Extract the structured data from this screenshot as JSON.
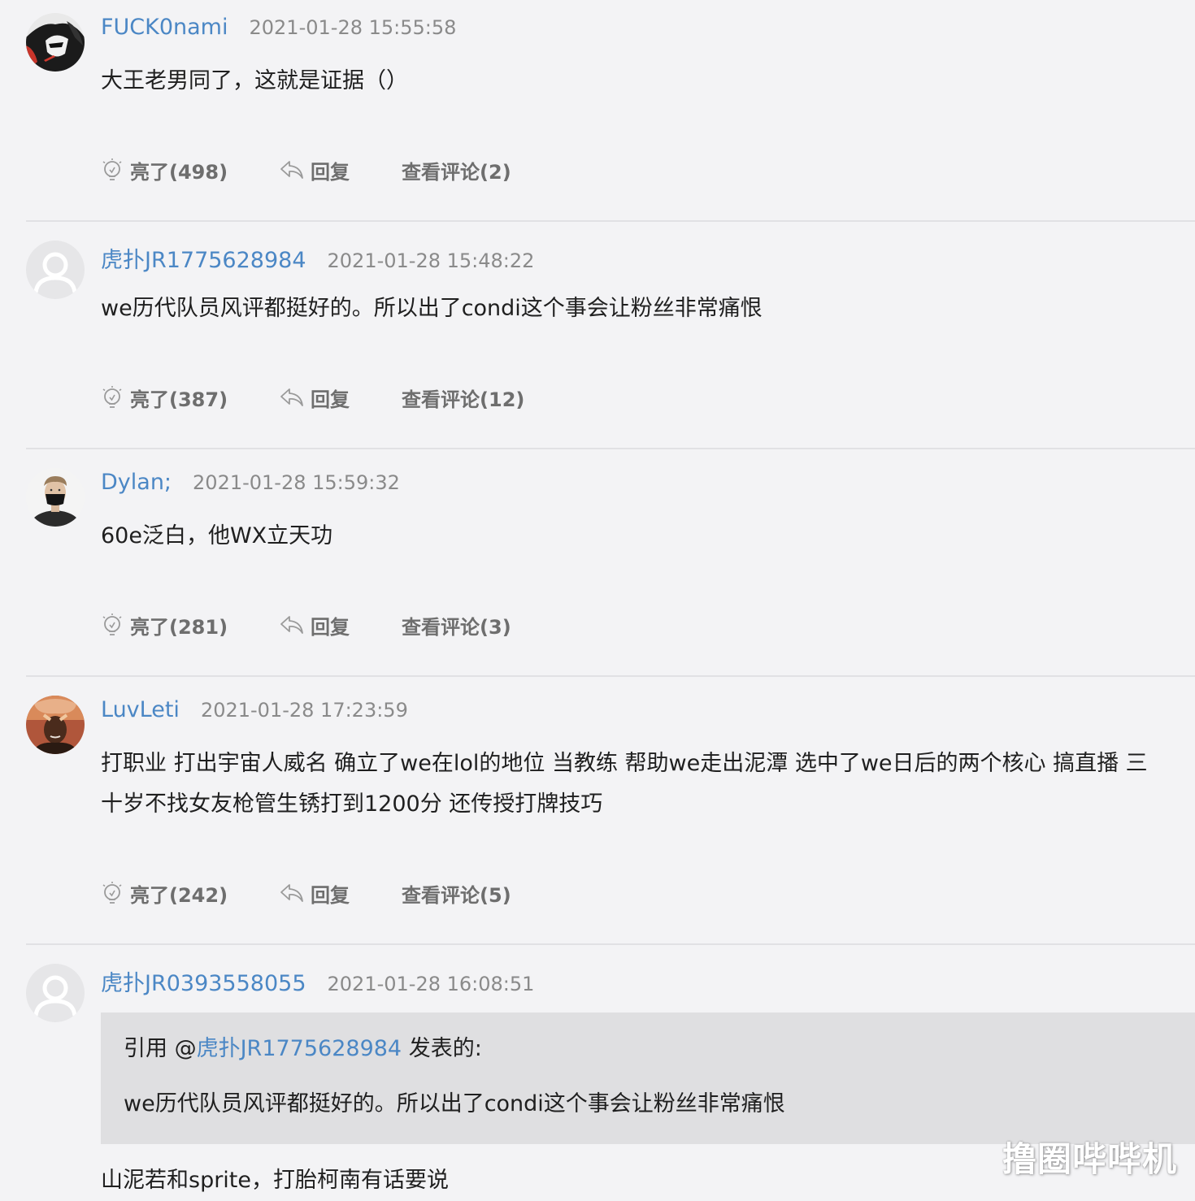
{
  "comments": [
    {
      "username": "FUCK0nami",
      "time": "2021-01-28 15:55:58",
      "text": "大王老男同了，这就是证据（）",
      "likes": "亮了(498)",
      "reply": "回复",
      "view": "查看评论(2)",
      "avatar": "dark-illustration-avatar"
    },
    {
      "username": "虎扑JR1775628984",
      "time": "2021-01-28 15:48:22",
      "text": "we历代队员风评都挺好的。所以出了condi这个事会让粉丝非常痛恨",
      "likes": "亮了(387)",
      "reply": "回复",
      "view": "查看评论(12)",
      "avatar": "default-user-avatar"
    },
    {
      "username": "Dylan;",
      "time": "2021-01-28 15:59:32",
      "text": "60e泛白，他WX立天功",
      "likes": "亮了(281)",
      "reply": "回复",
      "view": "查看评论(3)",
      "avatar": "masked-man-avatar"
    },
    {
      "username": "LuvLeti",
      "time": "2021-01-28 17:23:59",
      "text_line1": "打职业 打出宇宙人威名 确立了we在lol的地位 当教练 帮助we走出泥潭 选中了we日后的两个核心 搞直播 三",
      "text_line2": "十岁不找女友枪管生锈打到1200分 还传授打牌技巧",
      "likes": "亮了(242)",
      "reply": "回复",
      "view": "查看评论(5)",
      "avatar": "photo-avatar"
    },
    {
      "username": "虎扑JR0393558055",
      "time": "2021-01-28 16:08:51",
      "quote_prefix": "引用 @",
      "quote_user": "虎扑JR1775628984",
      "quote_suffix": " 发表的:",
      "quote_text": "we历代队员风评都挺好的。所以出了condi这个事会让粉丝非常痛恨",
      "text": "山泥若和sprite，打胎柯南有话要说",
      "avatar": "default-user-avatar"
    }
  ],
  "watermark": "撸圈哔哔机",
  "colors": {
    "background": "#f3f3f5",
    "username": "#4b87c5",
    "timestamp": "#8a8a8a",
    "action": "#6e6e6e",
    "quote_bg": "#dfdfe1"
  }
}
